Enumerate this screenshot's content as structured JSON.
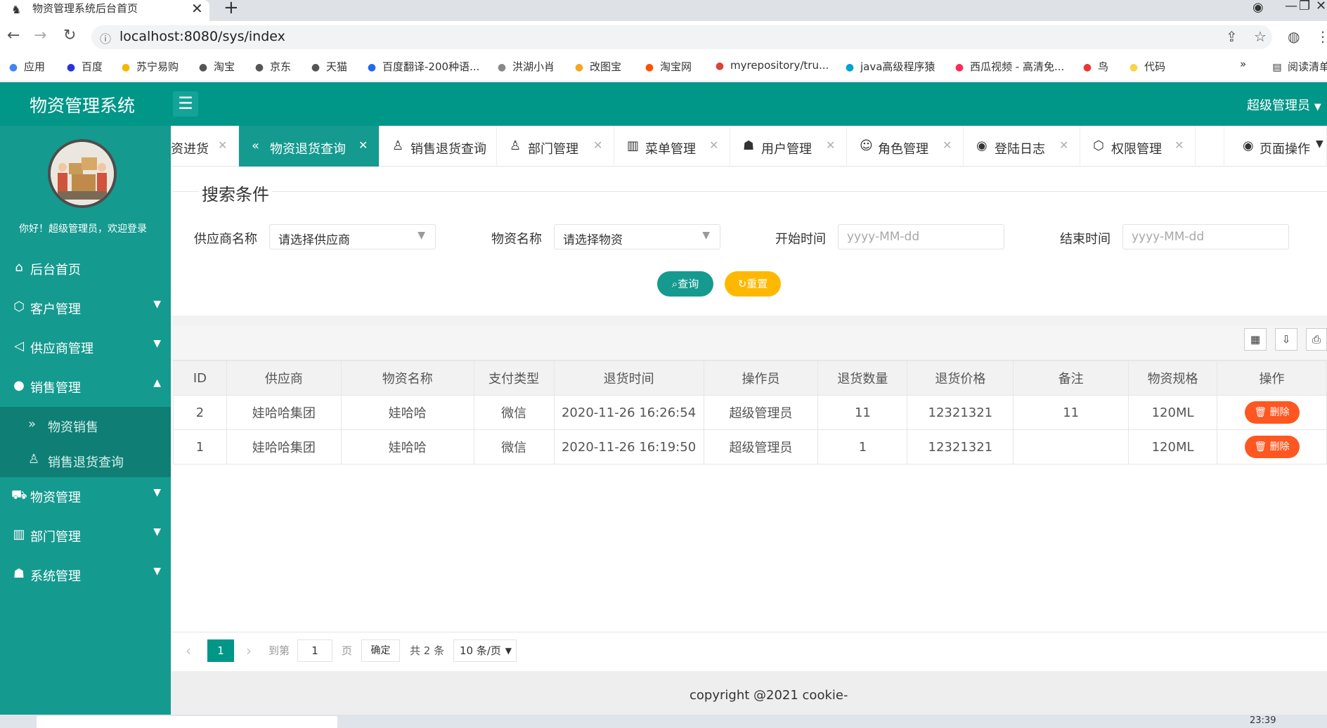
{
  "browser": {
    "tab_title": "物资管理系统后台首页",
    "url": "localhost:8080/sys/index",
    "bookmarks": [
      {
        "label": "应用",
        "icon": "apps-grid-icon",
        "color": "#4285f4"
      },
      {
        "label": "百度",
        "icon": "baidu-paw-icon",
        "color": "#2932e1"
      },
      {
        "label": "苏宁易购",
        "icon": "suning-icon",
        "color": "#f7b500"
      },
      {
        "label": "淘宝",
        "icon": "globe-icon",
        "color": "#555555"
      },
      {
        "label": "京东",
        "icon": "globe-icon",
        "color": "#555555"
      },
      {
        "label": "天猫",
        "icon": "globe-icon",
        "color": "#555555"
      },
      {
        "label": "百度翻译-200种语...",
        "icon": "translate-icon",
        "color": "#2468f2"
      },
      {
        "label": "洪湖小肖",
        "icon": "feather-icon",
        "color": "#888888"
      },
      {
        "label": "改图宝",
        "icon": "image-icon",
        "color": "#f5a623"
      },
      {
        "label": "淘宝网",
        "icon": "taobao-icon",
        "color": "#ff5000"
      },
      {
        "label": "myrepository/tru...",
        "icon": "chrome-icon",
        "color": "#db4437"
      },
      {
        "label": "java高级程序猿",
        "icon": "bilibili-icon",
        "color": "#00a1d6"
      },
      {
        "label": "西瓜视频 - 高清免...",
        "icon": "xigua-icon",
        "color": "#fe2c55"
      },
      {
        "label": "鸟",
        "icon": "bird-icon",
        "color": "#e53935"
      },
      {
        "label": "代码",
        "icon": "bulb-icon",
        "color": "#f7d44a"
      }
    ],
    "more": "»",
    "reading_list": "阅读清单"
  },
  "sidebar": {
    "app_title": "物资管理系统",
    "greeting": "你好！超级管理员，欢迎登录",
    "items": [
      {
        "label": "后台首页",
        "icon": "home-icon",
        "glyph": "⌂",
        "caret": ""
      },
      {
        "label": "客户管理",
        "icon": "cube-icon",
        "glyph": "⬡",
        "caret": "▼"
      },
      {
        "label": "供应商管理",
        "icon": "speaker-icon",
        "glyph": "◁",
        "caret": "▼"
      },
      {
        "label": "销售管理",
        "icon": "chat-icon",
        "glyph": "●",
        "caret": "▲"
      },
      {
        "label": "物资管理",
        "icon": "cart-icon",
        "glyph": "⛟",
        "caret": "▼"
      },
      {
        "label": "部门管理",
        "icon": "building-icon",
        "glyph": "▥",
        "caret": "▼"
      },
      {
        "label": "系统管理",
        "icon": "user-icon",
        "glyph": "☗",
        "caret": "▼"
      }
    ],
    "sub_items": [
      {
        "label": "物资销售",
        "icon": "double-chevron-icon",
        "glyph": "»"
      },
      {
        "label": "销售退货查询",
        "icon": "user-outline-icon",
        "glyph": "♙"
      }
    ]
  },
  "header": {
    "menu_glyph": "☰",
    "user": "超级管理员",
    "caret": "▼"
  },
  "page_tabs": [
    {
      "label": "资进货",
      "glyph": "",
      "icon": ""
    },
    {
      "label": "物资退货查询",
      "glyph": "«",
      "icon": "double-chevron-left-icon"
    },
    {
      "label": "销售退货查询",
      "glyph": "♙",
      "icon": "user-outline-icon"
    },
    {
      "label": "部门管理",
      "glyph": "♙",
      "icon": "user-outline-icon"
    },
    {
      "label": "菜单管理",
      "glyph": "▥",
      "icon": "building-icon"
    },
    {
      "label": "用户管理",
      "glyph": "☗",
      "icon": "user-icon"
    },
    {
      "label": "角色管理",
      "glyph": "☺",
      "icon": "smile-icon"
    },
    {
      "label": "登陆日志",
      "glyph": "◉",
      "icon": "weibo-icon"
    },
    {
      "label": "权限管理",
      "glyph": "⬡",
      "icon": "cube-icon"
    }
  ],
  "page_ops": {
    "label": "页面操作",
    "glyph": "◉",
    "caret": "▼"
  },
  "tab_close": "✕",
  "search": {
    "legend": "搜索条件",
    "supplier_label": "供应商名称",
    "supplier_value": "请选择供应商",
    "goods_label": "物资名称",
    "goods_value": "请选择物资",
    "start_label": "开始时间",
    "start_placeholder": "yyyy-MM-dd",
    "end_label": "结束时间",
    "end_placeholder": "yyyy-MM-dd",
    "query_button": "查询",
    "reset_button": "重置",
    "query_glyph": "⌕",
    "reset_glyph": "↻"
  },
  "table": {
    "columns": [
      "ID",
      "供应商",
      "物资名称",
      "支付类型",
      "退货时间",
      "操作员",
      "退货数量",
      "退货价格",
      "备注",
      "物资规格",
      "操作"
    ],
    "rows": [
      [
        "2",
        "娃哈哈集团",
        "娃哈哈",
        "微信",
        "2020-11-26 16:26:54",
        "超级管理员",
        "11",
        "12321321",
        "11",
        "120ML"
      ],
      [
        "1",
        "娃哈哈集团",
        "娃哈哈",
        "微信",
        "2020-11-26 16:19:50",
        "超级管理员",
        "1",
        "12321321",
        "",
        "120ML"
      ]
    ],
    "delete_label": "🗑 删除"
  },
  "pager": {
    "prev": "‹",
    "current": "1",
    "next": "›",
    "goto_label": "到第",
    "goto_value": "1",
    "page_unit": "页",
    "confirm": "确定",
    "total": "共 2 条",
    "page_size": "10 条/页"
  },
  "footer": {
    "copyright": "copyright @2021 cookie-"
  },
  "taskbar": {
    "clock": "23:39"
  },
  "colors": {
    "primary": "#009688",
    "sidebar": "#159a8f",
    "reset": "#ffb800",
    "danger": "#ff5722"
  }
}
